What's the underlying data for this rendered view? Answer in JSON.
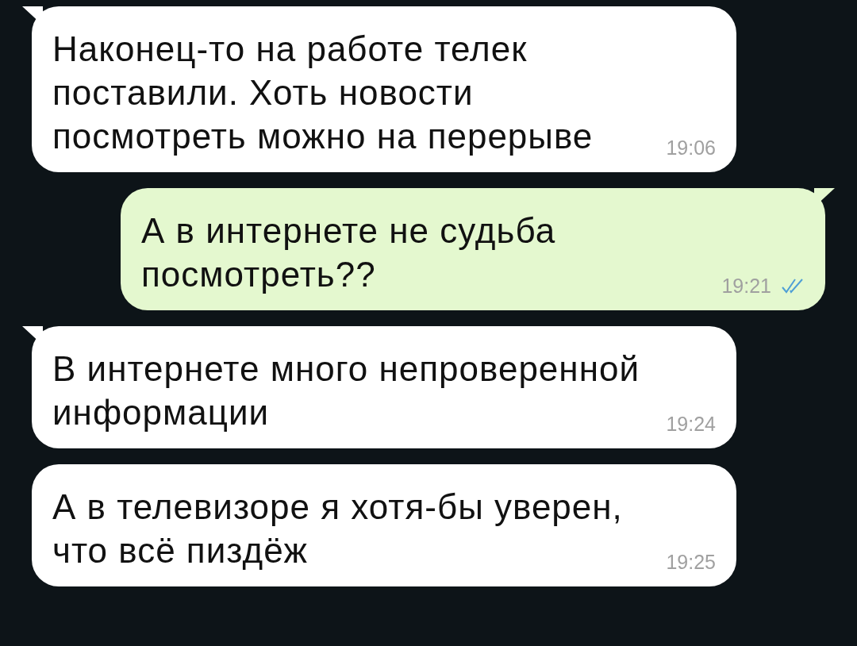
{
  "messages": [
    {
      "kind": "incoming",
      "tail": true,
      "text": "Наконец-то на работе телек\nпоставили. Хоть новости\nпосмотреть можно на перерыве",
      "time": "19:06"
    },
    {
      "kind": "outgoing",
      "tail": true,
      "text": "А в интернете не судьба\nпосмотреть??",
      "time": "19:21",
      "read": true
    },
    {
      "kind": "incoming",
      "tail": true,
      "text": "В интернете много непроверенной\nинформации",
      "time": "19:24"
    },
    {
      "kind": "incoming",
      "tail": false,
      "text": "А в телевизоре я хотя-бы уверен,\nчто всё пиздёж",
      "time": "19:25"
    }
  ]
}
